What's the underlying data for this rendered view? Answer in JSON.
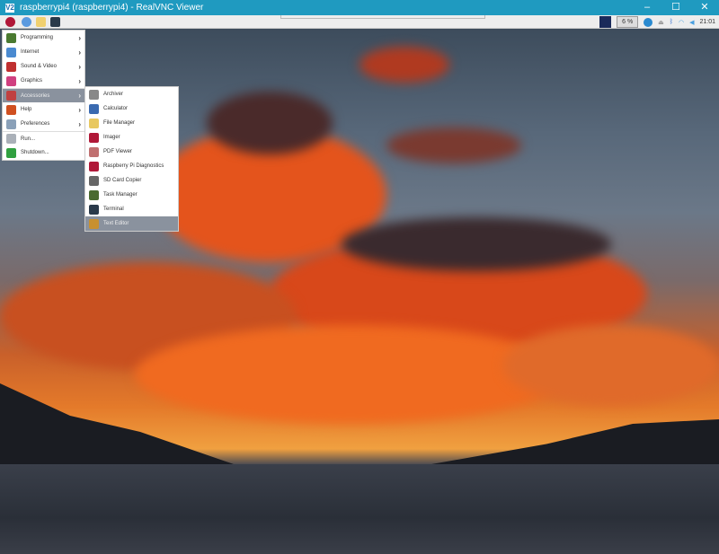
{
  "window": {
    "title": "raspberrypi4 (raspberrypi4) - RealVNC Viewer",
    "logo": "V2",
    "minimize": "–",
    "maximize": "☐",
    "close": "✕"
  },
  "taskbar": {
    "launchers": [
      "raspberry-menu-icon",
      "browser-icon",
      "file-manager-icon",
      "terminal-icon"
    ],
    "tray": {
      "cpu": "6 %",
      "clock": "21:01"
    }
  },
  "main_menu": [
    {
      "label": "Programming",
      "icon": "programming-icon",
      "color": "#4a7a30",
      "submenu": true
    },
    {
      "label": "Internet",
      "icon": "internet-icon",
      "color": "#4a8ad0",
      "submenu": true
    },
    {
      "label": "Sound & Video",
      "icon": "sound-video-icon",
      "color": "#c03030",
      "submenu": true
    },
    {
      "label": "Graphics",
      "icon": "graphics-icon",
      "color": "#d04080",
      "submenu": true
    },
    {
      "label": "Accessories",
      "icon": "accessories-icon",
      "color": "#c04040",
      "submenu": true
    },
    {
      "label": "Help",
      "icon": "help-icon",
      "color": "#d05020",
      "submenu": true
    },
    {
      "label": "Preferences",
      "icon": "preferences-icon",
      "color": "#8aa0b8",
      "submenu": true
    },
    {
      "label": "Run...",
      "icon": "run-icon",
      "color": "#aab0b8",
      "submenu": false
    },
    {
      "label": "Shutdown...",
      "icon": "shutdown-icon",
      "color": "#30a040",
      "submenu": false
    }
  ],
  "accessories_menu": [
    {
      "label": "Archiver",
      "icon": "archiver-icon",
      "color": "#888"
    },
    {
      "label": "Calculator",
      "icon": "calculator-icon",
      "color": "#3a6ab0"
    },
    {
      "label": "File Manager",
      "icon": "folder-icon",
      "color": "#e8c860"
    },
    {
      "label": "Imager",
      "icon": "raspberry-icon",
      "color": "#b01838"
    },
    {
      "label": "PDF Viewer",
      "icon": "pdf-viewer-icon",
      "color": "#c07070"
    },
    {
      "label": "Raspberry Pi Diagnostics",
      "icon": "raspberry-icon",
      "color": "#b01838"
    },
    {
      "label": "SD Card Copier",
      "icon": "sd-card-icon",
      "color": "#666"
    },
    {
      "label": "Task Manager",
      "icon": "task-manager-icon",
      "color": "#4a6a30"
    },
    {
      "label": "Terminal",
      "icon": "terminal-icon",
      "color": "#2a3a4a"
    },
    {
      "label": "Text Editor",
      "icon": "text-editor-icon",
      "color": "#c89030"
    }
  ]
}
